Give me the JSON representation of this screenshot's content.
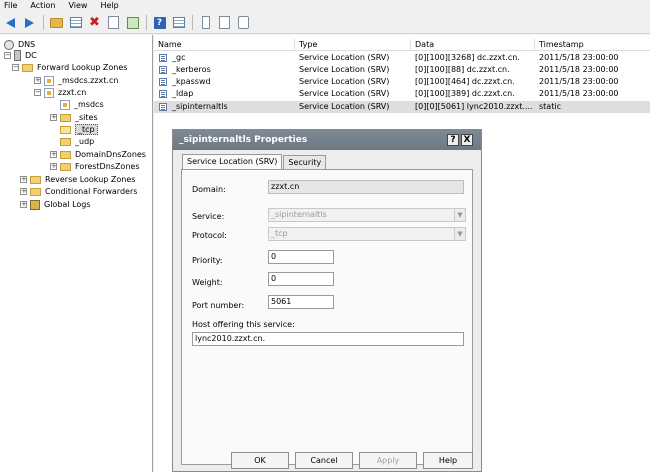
{
  "menu": [
    "File",
    "Action",
    "View",
    "Help"
  ],
  "toolbar_icons": [
    "back-arrow-icon",
    "forward-arrow-icon",
    "up-folder-icon",
    "show-hide-tree-icon",
    "delete-icon",
    "properties-icon",
    "export-list-icon",
    "help-icon",
    "console-icon",
    "new-record-icon",
    "new-zone-icon",
    "refresh-icon"
  ],
  "tree": {
    "root": "DNS",
    "server": "DC",
    "forward": "Forward Lookup Zones",
    "msdcs_zone": "_msdcs.zzxt.cn",
    "zone": "zzxt.cn",
    "msdcs": "_msdcs",
    "sites": "_sites",
    "tcp": "_tcp",
    "udp": "_udp",
    "domaindns": "DomainDnsZones",
    "forestdns": "ForestDnsZones",
    "reverse": "Reverse Lookup Zones",
    "conditional": "Conditional Forwarders",
    "logs": "Global Logs"
  },
  "list": {
    "columns": [
      "Name",
      "Type",
      "Data",
      "Timestamp"
    ],
    "rows": [
      {
        "name": "_gc",
        "type": "Service Location (SRV)",
        "data": "[0][100][3268] dc.zzxt.cn.",
        "timestamp": "2011/5/18 23:00:00"
      },
      {
        "name": "_kerberos",
        "type": "Service Location (SRV)",
        "data": "[0][100][88] dc.zzxt.cn.",
        "timestamp": "2011/5/18 23:00:00"
      },
      {
        "name": "_kpasswd",
        "type": "Service Location (SRV)",
        "data": "[0][100][464] dc.zzxt.cn.",
        "timestamp": "2011/5/18 23:00:00"
      },
      {
        "name": "_ldap",
        "type": "Service Location (SRV)",
        "data": "[0][100][389] dc.zzxt.cn.",
        "timestamp": "2011/5/18 23:00:00"
      },
      {
        "name": "_sipinternaltls",
        "type": "Service Location (SRV)",
        "data": "[0][0][5061] lync2010.zzxt....",
        "timestamp": "static"
      }
    ]
  },
  "dialog": {
    "title": "_sipinternaltls Properties",
    "help_btn": "?",
    "close_btn": "X",
    "tabs": [
      "Service Location (SRV)",
      "Security"
    ],
    "domain_label": "Domain:",
    "domain_value": "zzxt.cn",
    "service_label": "Service:",
    "service_value": "_sipinternaltls",
    "protocol_label": "Protocol:",
    "protocol_value": "_tcp",
    "priority_label": "Priority:",
    "priority_value": "0",
    "weight_label": "Weight:",
    "weight_value": "0",
    "port_label": "Port number:",
    "port_value": "5061",
    "host_label": "Host offering this service:",
    "host_value": "lync2010.zzxt.cn.",
    "ok": "OK",
    "cancel": "Cancel",
    "apply": "Apply",
    "help": "Help"
  },
  "colors": {
    "title_bar": "#737f8a",
    "selection": "#dedede",
    "folder": "#f0d070"
  }
}
